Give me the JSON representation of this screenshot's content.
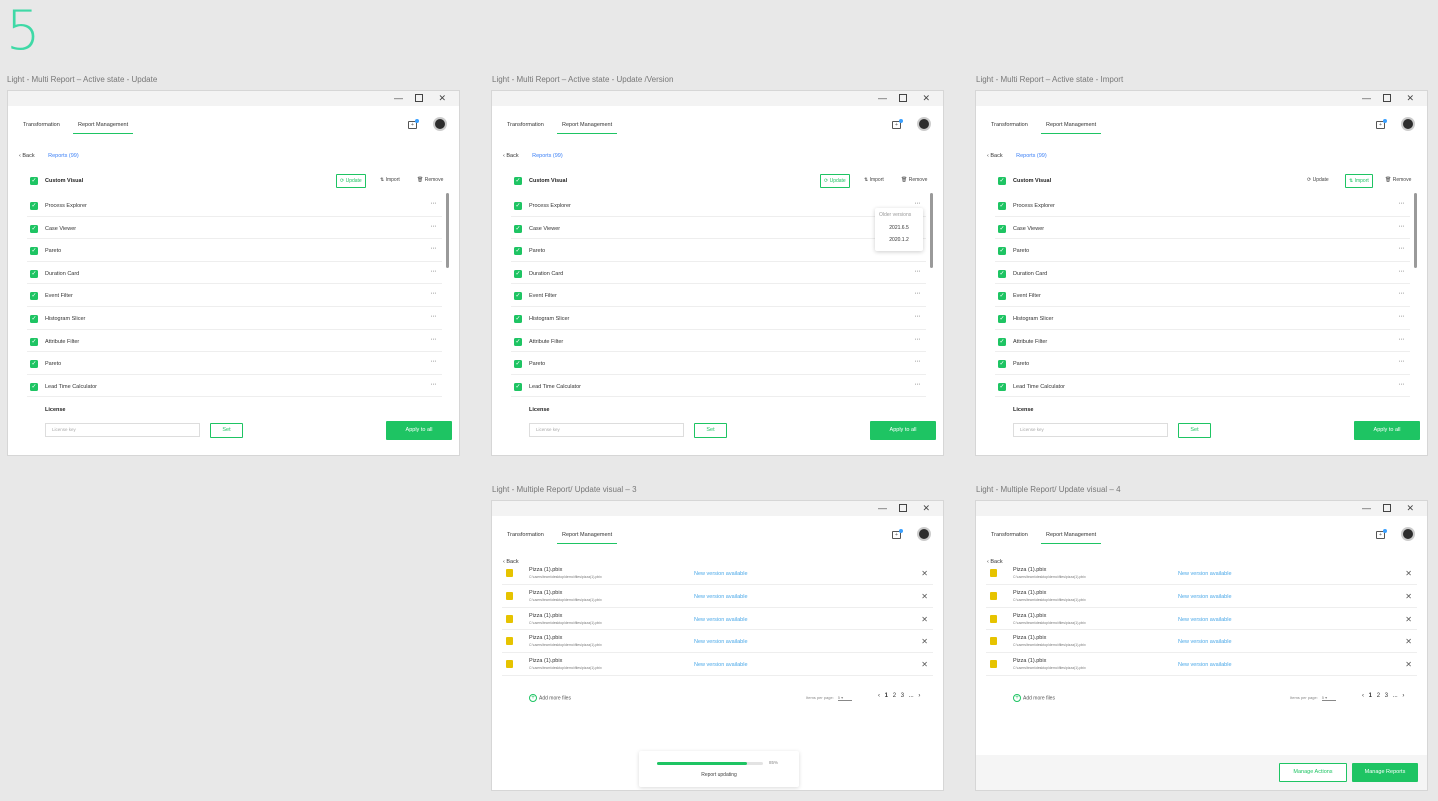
{
  "step_number": "5",
  "frames": [
    {
      "title": "Light - Multi Report – Active state - Update",
      "active_action": "update"
    },
    {
      "title": "Light - Multi Report – Active state - Update /Version",
      "active_action": "update"
    },
    {
      "title": "Light - Multi Report – Active state - Import",
      "active_action": "import"
    },
    {
      "title": "Light - Multiple Report/ Update visual – 3"
    },
    {
      "title": "Light - Multiple Report/ Update visual – 4"
    }
  ],
  "window": {
    "minimize": "—",
    "close": "✕"
  },
  "nav": {
    "tab1": "Transformation",
    "tab2": "Report Management"
  },
  "breadcrumb": {
    "back": "‹  Back",
    "reports": "Reports (99)"
  },
  "visuals": {
    "header": "Custom Visual",
    "actions": {
      "update": "Update",
      "import": "Import",
      "remove": "Remove"
    },
    "items": [
      "Process Explorer",
      "Case Viewer",
      "Pareto",
      "Duration Card",
      "Event Filter",
      "Histogram Slicer",
      "Attribute Filter",
      "Pareto",
      "Lead Time Calculator"
    ]
  },
  "license": {
    "label": "License",
    "placeholder": "License key",
    "set": "Set",
    "apply": "Apply to all"
  },
  "versions": {
    "header": "Older versions",
    "items": [
      "2021.6.5",
      "2020.1.2"
    ]
  },
  "files": {
    "items": [
      {
        "name": "Pizza (1).pbix",
        "path": "C:\\users\\team\\desktop\\demo\\files\\pizza(1).pbix",
        "status": "New version available"
      },
      {
        "name": "Pizza (1).pbix",
        "path": "C:\\users\\team\\desktop\\demo\\files\\pizza(1).pbix",
        "status": "New version available"
      },
      {
        "name": "Pizza (1).pbix",
        "path": "C:\\users\\team\\desktop\\demo\\files\\pizza(1).pbix",
        "status": "New version available"
      },
      {
        "name": "Pizza (1).pbix",
        "path": "C:\\users\\team\\desktop\\demo\\files\\pizza(1).pbix",
        "status": "New version available"
      },
      {
        "name": "Pizza (1).pbix",
        "path": "C:\\users\\team\\desktop\\demo\\files\\pizza(1).pbix",
        "status": "New version available"
      }
    ],
    "add_more": "Add more files",
    "items_per_page": "Items per page:",
    "items_per_page_value": "5",
    "pages": [
      "1",
      "2",
      "3",
      "..."
    ]
  },
  "progress": {
    "percent": 85,
    "percent_label": "85%",
    "label": "Report updating"
  },
  "footer": {
    "manage_actions": "Manage Actions",
    "manage_reports": "Manage Reports"
  },
  "colors": {
    "accent": "#1ec463",
    "link": "#3a7ff6",
    "status": "#4aa8e8",
    "heading": "#3fd9a6"
  }
}
